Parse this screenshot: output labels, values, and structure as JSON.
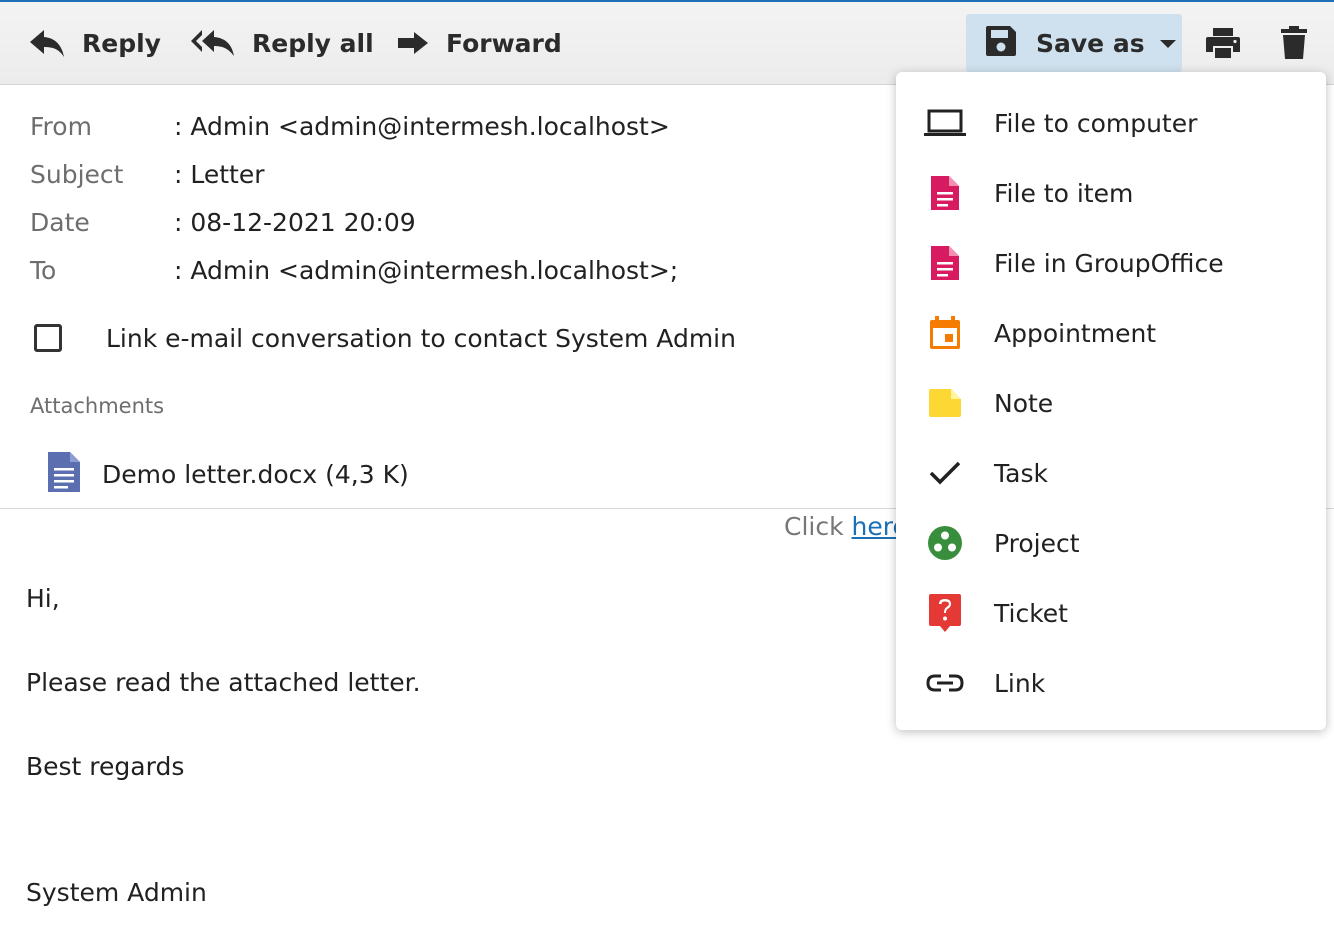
{
  "toolbar": {
    "reply_label": "Reply",
    "reply_all_label": "Reply all",
    "forward_label": "Forward",
    "save_as_label": "Save as"
  },
  "header": {
    "from_label": "From",
    "from_value": ": Admin <admin@intermesh.localhost>",
    "subject_label": "Subject",
    "subject_value": ": Letter",
    "date_label": "Date",
    "date_value": ": 08-12-2021 20:09",
    "to_label": "To",
    "to_value": ": Admin <admin@intermesh.localhost>;"
  },
  "link_contact": {
    "label": "Link e-mail conversation to contact System Admin",
    "checked": false
  },
  "attachments": {
    "label": "Attachments",
    "items": [
      {
        "name": "Demo letter.docx (4,3 K)",
        "icon": "docx-file-icon"
      }
    ]
  },
  "notice": {
    "prefix": "Click ",
    "link": "here"
  },
  "body": {
    "lines": [
      "Hi,",
      "Please read the attached letter.",
      "Best regards",
      "System Admin"
    ]
  },
  "save_menu": {
    "items": [
      {
        "label": "File to computer",
        "icon": "laptop-icon",
        "color": "#212121"
      },
      {
        "label": "File to item",
        "icon": "file-document-icon",
        "color": "#d81b60"
      },
      {
        "label": "File in GroupOffice",
        "icon": "file-document-icon",
        "color": "#d81b60"
      },
      {
        "label": "Appointment",
        "icon": "calendar-icon",
        "color": "#f57c00"
      },
      {
        "label": "Note",
        "icon": "note-icon",
        "color": "#fdd835"
      },
      {
        "label": "Task",
        "icon": "check-icon",
        "color": "#212121"
      },
      {
        "label": "Project",
        "icon": "project-icon",
        "color": "#388e3c"
      },
      {
        "label": "Ticket",
        "icon": "ticket-question-icon",
        "color": "#e53935"
      },
      {
        "label": "Link",
        "icon": "link-icon",
        "color": "#212121"
      }
    ]
  },
  "colors": {
    "accent": "#1e6fb5",
    "save_button_bg": "#cfe1ee",
    "link": "#1a6fb5"
  }
}
